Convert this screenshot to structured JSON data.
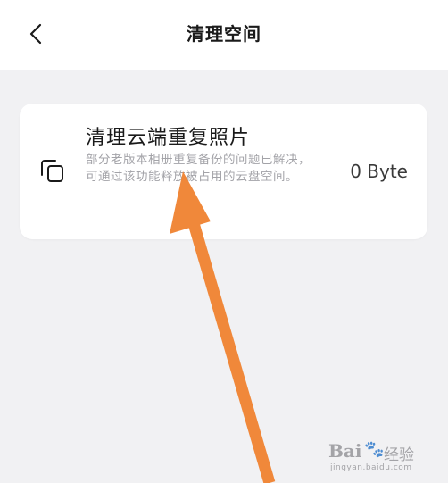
{
  "header": {
    "title": "清理空间",
    "back_icon": "chevron-left-icon"
  },
  "card": {
    "icon": "copy-icon",
    "title": "清理云端重复照片",
    "description_line1": "部分老版本相册重复备份的问题已解决，",
    "description_line2": "可通过该功能释放被占用的云盘空间。",
    "size": "0 Byte"
  },
  "watermark": {
    "logo": "Bai",
    "paw": "🐾",
    "cn": "经验",
    "url": "jingyan.baidu.com"
  },
  "colors": {
    "background": "#f1f1f3",
    "card": "#ffffff",
    "arrow": "#f0883a",
    "desc_text": "#a3a3a8"
  }
}
